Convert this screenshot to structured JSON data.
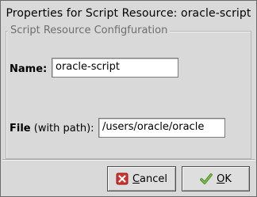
{
  "window": {
    "title": "Properties for Script Resource: oracle-script"
  },
  "frame": {
    "legend": "Script Resource Configfuration"
  },
  "fields": {
    "name": {
      "label": "Name:",
      "value": "oracle-script"
    },
    "file": {
      "label_bold": "File",
      "label_rest": " (with path):",
      "value": "/users/oracle/oracle"
    }
  },
  "buttons": {
    "cancel": {
      "mnemonic": "C",
      "rest": "ancel",
      "icon": "cancel-x-icon"
    },
    "ok": {
      "mnemonic": "O",
      "rest": "K",
      "icon": "checkmark-icon"
    }
  },
  "colors": {
    "dialog_bg": "#d9d9d9",
    "cancel_icon": "#d1332f",
    "ok_icon": "#5aa02c"
  }
}
